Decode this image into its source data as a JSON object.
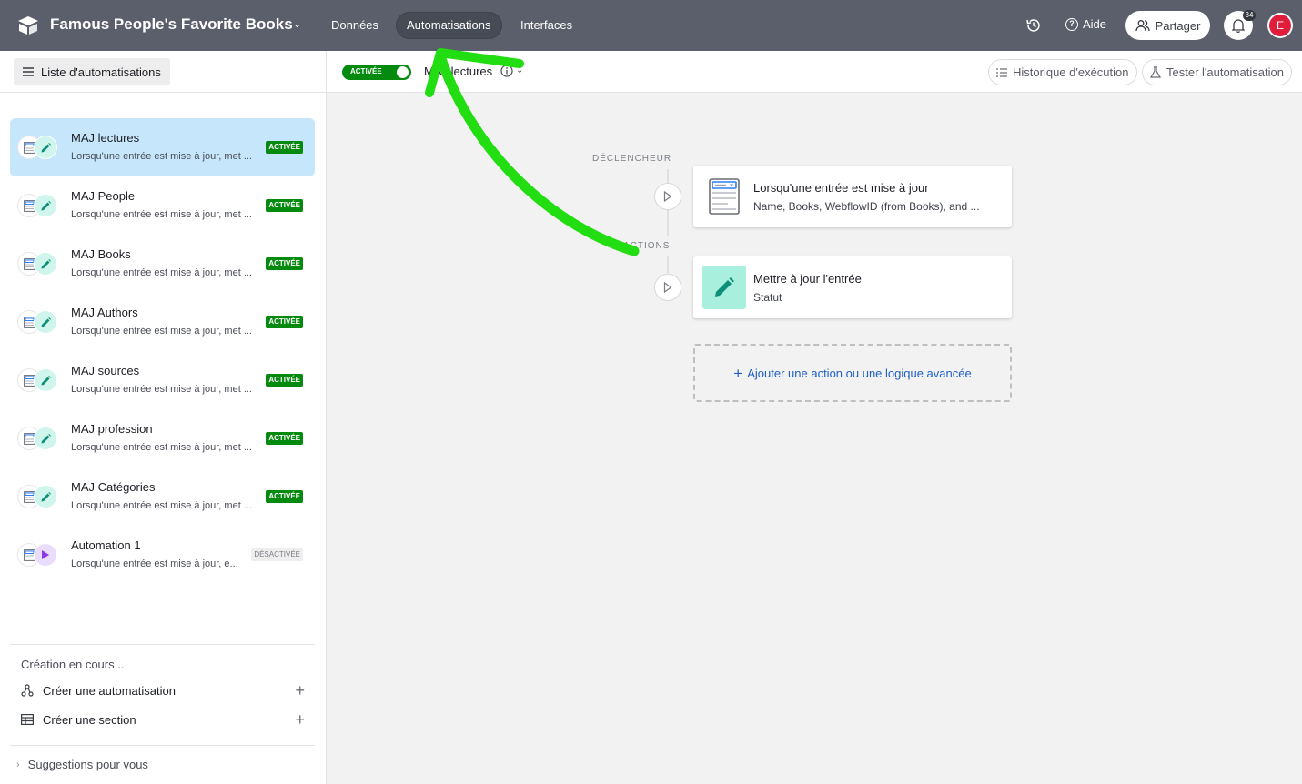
{
  "topbar": {
    "base_title": "Famous People's Favorite Books",
    "tabs": [
      {
        "label": "Données"
      },
      {
        "label": "Automatisations"
      },
      {
        "label": "Interfaces"
      }
    ],
    "help_label": "Aide",
    "share_label": "Partager",
    "notification_count": "34",
    "avatar_initial": "E"
  },
  "sidebar": {
    "list_button_label": "Liste d'automatisations",
    "items": [
      {
        "name": "MAJ lectures",
        "desc": "Lorsqu'une entrée est mise à jour, met ...",
        "status": "ACTIVÉE"
      },
      {
        "name": "MAJ People",
        "desc": "Lorsqu'une entrée est mise à jour, met ...",
        "status": "ACTIVÉE"
      },
      {
        "name": "MAJ Books",
        "desc": "Lorsqu'une entrée est mise à jour, met ...",
        "status": "ACTIVÉE"
      },
      {
        "name": "MAJ Authors",
        "desc": "Lorsqu'une entrée est mise à jour, met ...",
        "status": "ACTIVÉE"
      },
      {
        "name": "MAJ sources",
        "desc": "Lorsqu'une entrée est mise à jour, met ...",
        "status": "ACTIVÉE"
      },
      {
        "name": "MAJ profession",
        "desc": "Lorsqu'une entrée est mise à jour, met ...",
        "status": "ACTIVÉE"
      },
      {
        "name": "MAJ Catégories",
        "desc": "Lorsqu'une entrée est mise à jour, met ...",
        "status": "ACTIVÉE"
      },
      {
        "name": "Automation 1",
        "desc": "Lorsqu'une entrée est mise à jour, e...",
        "status": "DÉSACTIVÉE"
      }
    ],
    "creating_label": "Création en cours...",
    "create_automation_label": "Créer une automatisation",
    "create_section_label": "Créer une section",
    "suggestions_label": "Suggestions pour vous"
  },
  "canvas": {
    "toggle_label": "ACTIVÉE",
    "current_name": "MAJ lectures",
    "history_button": "Historique d'exécution",
    "test_button": "Tester l'automatisation",
    "trigger_label": "DÉCLENCHEUR",
    "actions_label": "ACTIONS",
    "trigger_card": {
      "title": "Lorsqu'une entrée est mise à jour",
      "subtitle": "Name, Books, WebflowID (from Books), and ..."
    },
    "action_card": {
      "title": "Mettre à jour l'entrée",
      "subtitle": "Statut"
    },
    "add_action_label": "Ajouter une action ou une logique avancée"
  },
  "colors": {
    "topbar": "#5b5f6b",
    "active_badge": "#048a0e",
    "selected_item": "#c5e6fb",
    "link_blue": "#1f5fc8",
    "annotation_arrow": "#22dd11"
  }
}
